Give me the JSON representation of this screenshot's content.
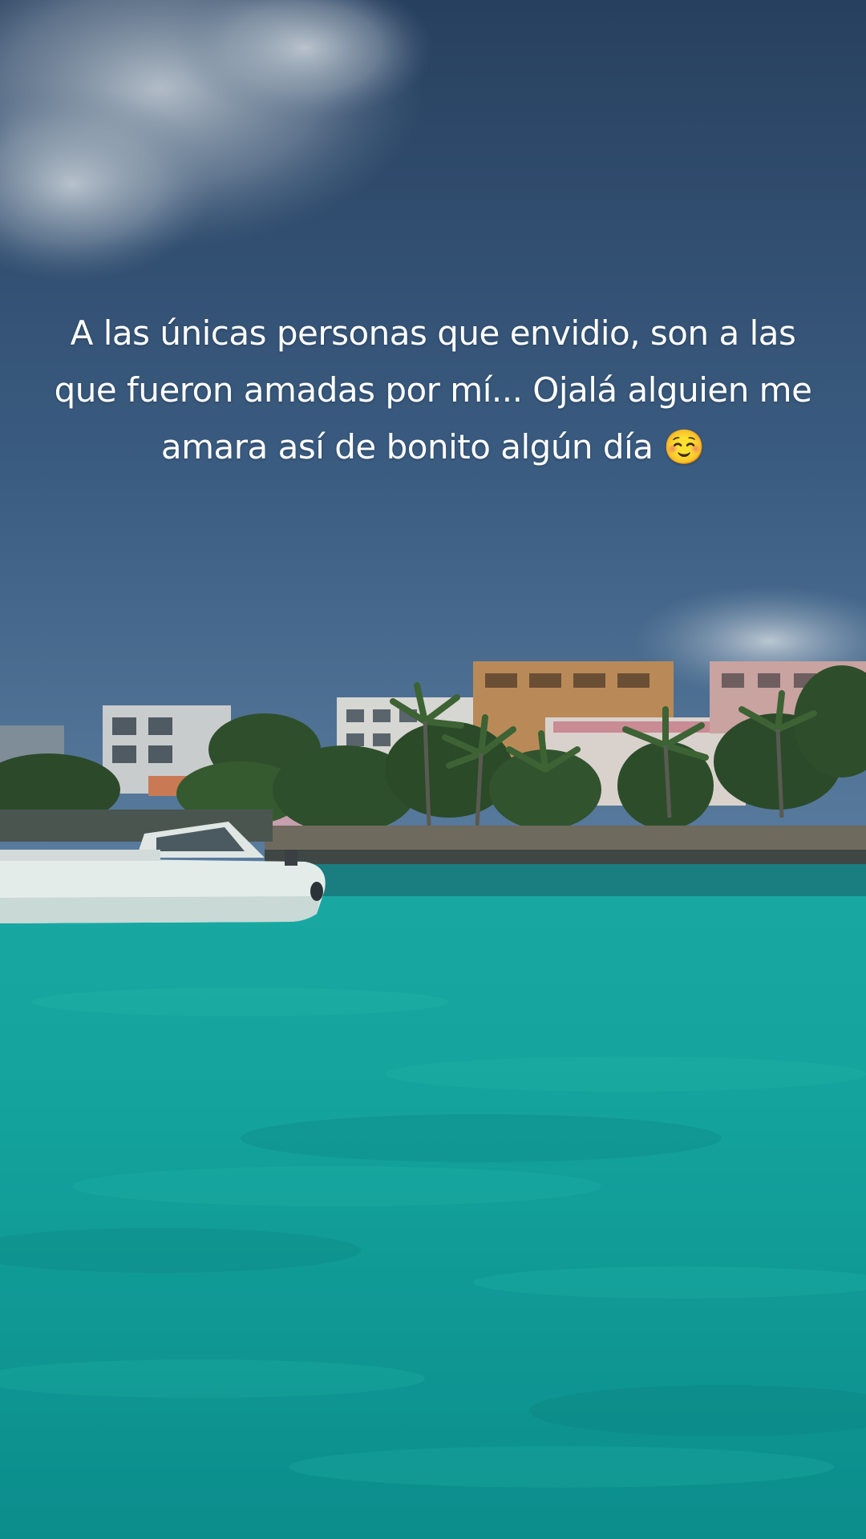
{
  "overlay_text": {
    "caption": "A las únicas personas que envidio, son a las que fueron amadas por mí... Ojalá alguien me amara así de bonito algún día ☺️"
  },
  "colors": {
    "sky_top": "#2a4668",
    "sky_bottom": "#44678c",
    "sea_near": "#0f9e9a",
    "sea_far": "#1fb0a8",
    "text": "#ffffff"
  },
  "scene_elements": [
    "cloud",
    "coastline-buildings",
    "palm-trees",
    "motor-yacht",
    "turquoise-sea"
  ]
}
